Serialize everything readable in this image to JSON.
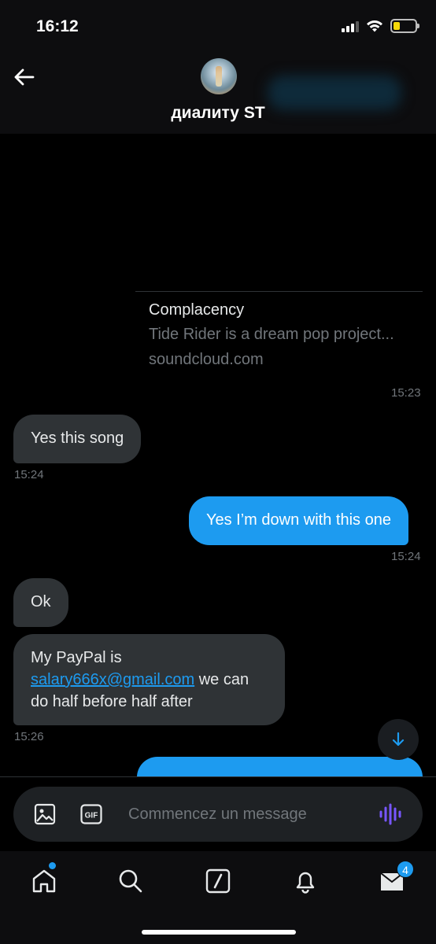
{
  "status_bar": {
    "time": "16:12",
    "battery_level": 0.3
  },
  "header": {
    "contact_name": "диалиту ST"
  },
  "link_card": {
    "title": "Complacency",
    "description": "Tide Rider is a dream pop project...",
    "domain": "soundcloud.com",
    "timestamp": "15:23"
  },
  "messages": [
    {
      "direction": "in",
      "text": "Yes this song",
      "timestamp": "15:24"
    },
    {
      "direction": "out",
      "text": "Yes I’m down with this one",
      "timestamp": "15:24"
    },
    {
      "direction": "in",
      "text": "Ok"
    },
    {
      "direction": "in",
      "text_before": "My PayPal is",
      "email": "salary666x@gmail.com",
      "text_after": "we can do half before half after",
      "timestamp": "15:26"
    }
  ],
  "composer": {
    "placeholder": "Commencez un message"
  },
  "tabbar": {
    "messages_badge": "4"
  },
  "colors": {
    "accent": "#1d9bf0",
    "incoming_bubble": "#2f3336",
    "background": "#000000"
  }
}
